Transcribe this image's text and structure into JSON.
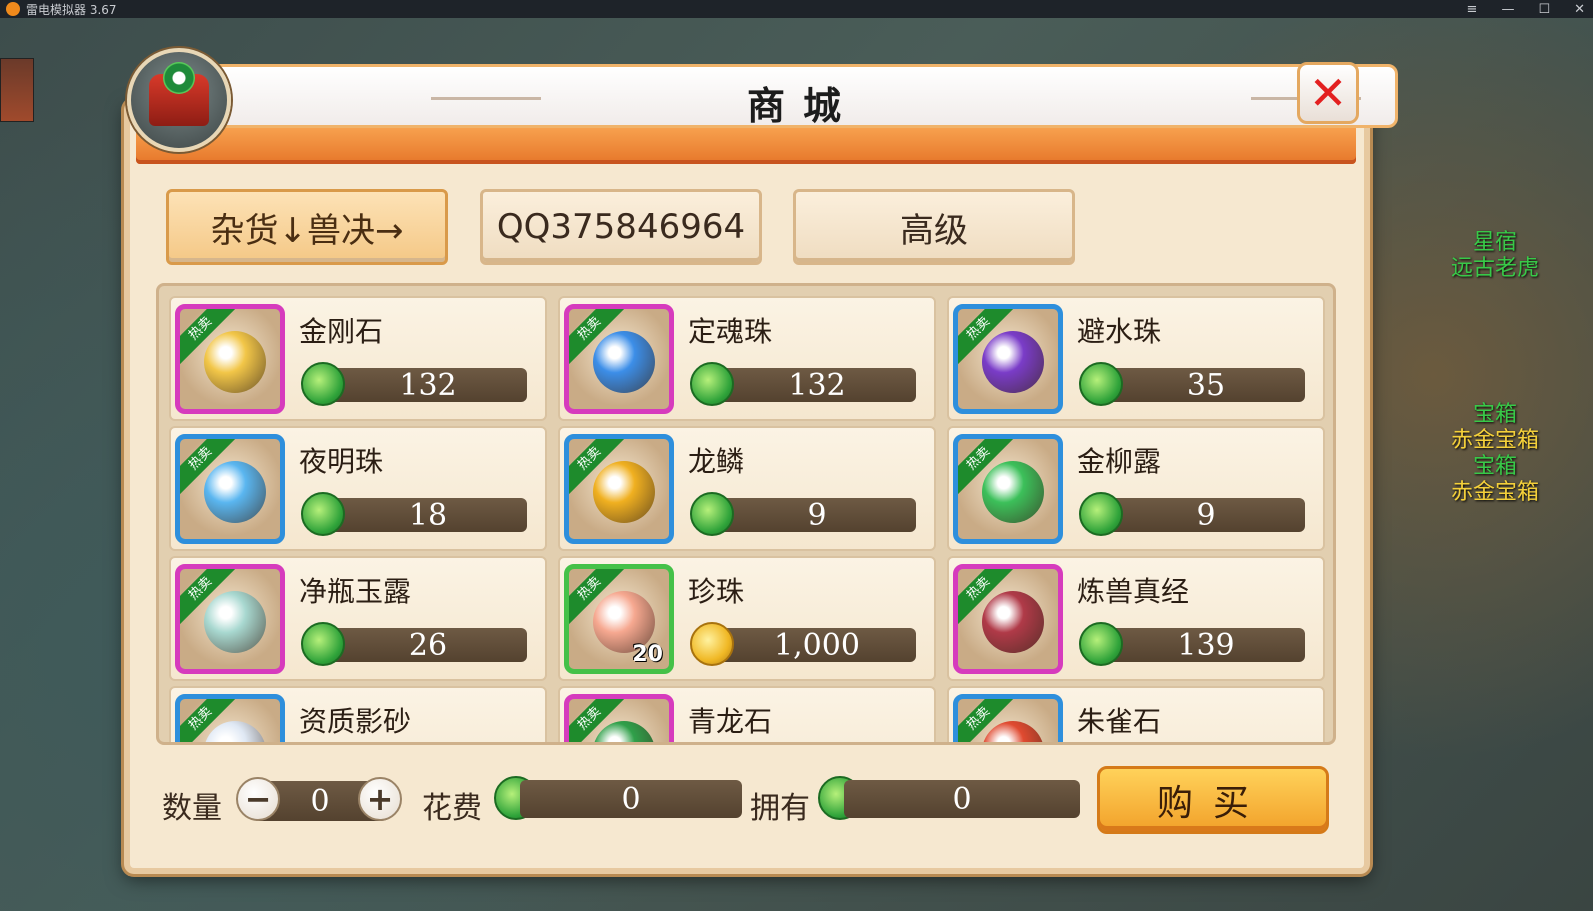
{
  "titlebar": {
    "app_name": "雷电模拟器 3.67",
    "min": "—",
    "max": "☐",
    "close": "✕",
    "menu": "≡"
  },
  "npc": {
    "label1": "星宿",
    "label2": "远古老虎",
    "label3": "宝箱",
    "label4": "赤金宝箱",
    "label5": "宝箱",
    "label6": "赤金宝箱"
  },
  "window": {
    "title": "商城",
    "close_icon": "close-icon"
  },
  "tabs": [
    {
      "label": "杂货↓兽决→",
      "active": true
    },
    {
      "label": "QQ375846964",
      "active": false
    },
    {
      "label": "高级",
      "active": false
    }
  ],
  "hot_label": "热卖",
  "items": [
    {
      "name": "金刚石",
      "price": "132",
      "currency": "jade",
      "frame": "magenta",
      "gem_color": "#f2c648"
    },
    {
      "name": "定魂珠",
      "price": "132",
      "currency": "jade",
      "frame": "magenta",
      "gem_color": "#3c8ee8"
    },
    {
      "name": "避水珠",
      "price": "35",
      "currency": "jade",
      "frame": "blue",
      "gem_color": "#7a3cc8"
    },
    {
      "name": "夜明珠",
      "price": "18",
      "currency": "jade",
      "frame": "blue",
      "gem_color": "#5ab6f0"
    },
    {
      "name": "龙鳞",
      "price": "9",
      "currency": "jade",
      "frame": "blue",
      "gem_color": "#f0b020"
    },
    {
      "name": "金柳露",
      "price": "9",
      "currency": "jade",
      "frame": "blue",
      "gem_color": "#3cc05a"
    },
    {
      "name": "净瓶玉露",
      "price": "26",
      "currency": "jade",
      "frame": "magenta",
      "gem_color": "#a8d8d0"
    },
    {
      "name": "珍珠",
      "price": "1,000",
      "currency": "gold",
      "frame": "green",
      "gem_color": "#f6a890",
      "stack": "20"
    },
    {
      "name": "炼兽真经",
      "price": "139",
      "currency": "jade",
      "frame": "magenta",
      "gem_color": "#b03a48"
    },
    {
      "name": "资质影砂",
      "price": "",
      "currency": "jade",
      "frame": "blue",
      "gem_color": "#dfe8f4"
    },
    {
      "name": "青龙石",
      "price": "",
      "currency": "jade",
      "frame": "magenta",
      "gem_color": "#30a04a"
    },
    {
      "name": "朱雀石",
      "price": "",
      "currency": "jade",
      "frame": "blue",
      "gem_color": "#e04a30"
    }
  ],
  "bottom": {
    "qty_label": "数量",
    "qty_value": "0",
    "minus": "−",
    "plus": "+",
    "cost_label": "花费",
    "cost_value": "0",
    "own_label": "拥有",
    "own_value": "0",
    "buy_label": "购买"
  }
}
